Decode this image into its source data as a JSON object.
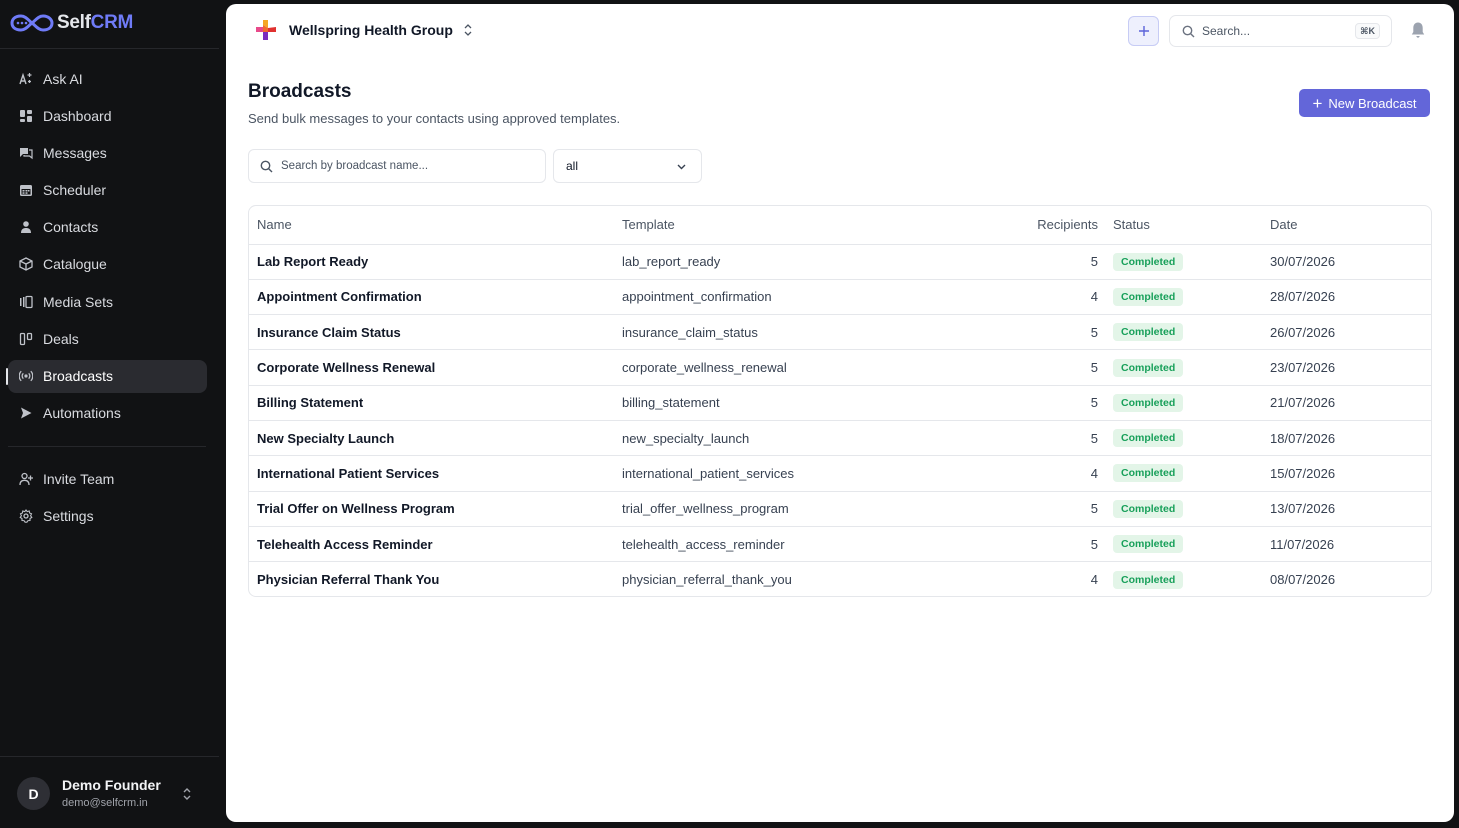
{
  "app": {
    "brand_self": "Self",
    "brand_crm": "CRM"
  },
  "colors": {
    "accent": "#6366d9",
    "sidebar_bg": "#111214",
    "badge_bg": "#e3f5e8",
    "badge_text": "#18a05a"
  },
  "sidebar": {
    "items": [
      {
        "label": "Ask AI",
        "icon": "sparkle-ai-icon"
      },
      {
        "label": "Dashboard",
        "icon": "dashboard-grid-icon"
      },
      {
        "label": "Messages",
        "icon": "chat-bubbles-icon"
      },
      {
        "label": "Scheduler",
        "icon": "calendar-icon"
      },
      {
        "label": "Contacts",
        "icon": "user-icon"
      },
      {
        "label": "Catalogue",
        "icon": "box-package-icon"
      },
      {
        "label": "Media Sets",
        "icon": "media-gallery-icon"
      },
      {
        "label": "Deals",
        "icon": "kanban-icon"
      },
      {
        "label": "Broadcasts",
        "icon": "broadcast-radio-icon"
      },
      {
        "label": "Automations",
        "icon": "play-flow-icon"
      }
    ],
    "secondary": [
      {
        "label": "Invite Team",
        "icon": "user-plus-icon"
      },
      {
        "label": "Settings",
        "icon": "gear-icon"
      }
    ],
    "active": "Broadcasts",
    "user": {
      "initial": "D",
      "name": "Demo Founder",
      "email": "demo@selfcrm.in"
    }
  },
  "topbar": {
    "org_name": "Wellspring Health Group",
    "search_placeholder": "Search...",
    "shortcut": "⌘K"
  },
  "page": {
    "title": "Broadcasts",
    "subtitle": "Send bulk messages to your contacts using approved templates.",
    "new_button": "New Broadcast",
    "search_placeholder": "Search by broadcast name...",
    "filter_value": "all"
  },
  "table": {
    "headers": [
      "Name",
      "Template",
      "Recipients",
      "Status",
      "Date"
    ],
    "rows": [
      {
        "name": "Lab Report Ready",
        "template": "lab_report_ready",
        "recipients": "5",
        "status": "Completed",
        "date": "30/07/2026"
      },
      {
        "name": "Appointment Confirmation",
        "template": "appointment_confirmation",
        "recipients": "4",
        "status": "Completed",
        "date": "28/07/2026"
      },
      {
        "name": "Insurance Claim Status",
        "template": "insurance_claim_status",
        "recipients": "5",
        "status": "Completed",
        "date": "26/07/2026"
      },
      {
        "name": "Corporate Wellness Renewal",
        "template": "corporate_wellness_renewal",
        "recipients": "5",
        "status": "Completed",
        "date": "23/07/2026"
      },
      {
        "name": "Billing Statement",
        "template": "billing_statement",
        "recipients": "5",
        "status": "Completed",
        "date": "21/07/2026"
      },
      {
        "name": "New Specialty Launch",
        "template": "new_specialty_launch",
        "recipients": "5",
        "status": "Completed",
        "date": "18/07/2026"
      },
      {
        "name": "International Patient Services",
        "template": "international_patient_services",
        "recipients": "4",
        "status": "Completed",
        "date": "15/07/2026"
      },
      {
        "name": "Trial Offer on Wellness Program",
        "template": "trial_offer_wellness_program",
        "recipients": "5",
        "status": "Completed",
        "date": "13/07/2026"
      },
      {
        "name": "Telehealth Access Reminder",
        "template": "telehealth_access_reminder",
        "recipients": "5",
        "status": "Completed",
        "date": "11/07/2026"
      },
      {
        "name": "Physician Referral Thank You",
        "template": "physician_referral_thank_you",
        "recipients": "4",
        "status": "Completed",
        "date": "08/07/2026"
      }
    ]
  }
}
